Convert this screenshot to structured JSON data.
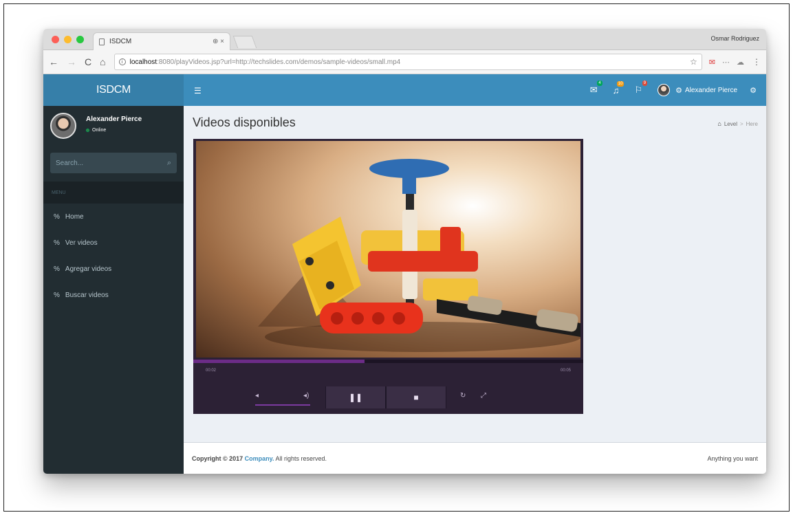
{
  "browser": {
    "tab_title": "ISDCM",
    "tab_close": "⊕ ×",
    "profile": "Osmar Rodriguez",
    "url_host": "localhost",
    "url_path": ":8080/playVideos.jsp?url=http://techslides.com/demos/sample-videos/small.mp4"
  },
  "app": {
    "logo": "ISDCM",
    "user_name": "Alexander Pierce",
    "user_status": "Online",
    "search_placeholder": "Search...",
    "menu_header": "MENU",
    "menu_items": [
      {
        "label": "Home"
      },
      {
        "label": "Ver videos"
      },
      {
        "label": "Agregar videos"
      },
      {
        "label": "Buscar videos"
      }
    ],
    "badges": {
      "messages": "4",
      "notifications": "10",
      "tasks": "9"
    }
  },
  "content": {
    "title": "Videos disponibles",
    "breadcrumb": {
      "level": "Level",
      "here": "Here"
    }
  },
  "player": {
    "time_current": "00:02",
    "time_duration": "00:05",
    "progress": 0.44,
    "volume": 1.0,
    "colors": {
      "frame": "#2c2135",
      "accent": "#6c2c87"
    }
  },
  "footer": {
    "copyright_prefix": "Copyright © 2017",
    "company": "Company.",
    "rights": "All rights reserved.",
    "right_text": "Anything you want"
  },
  "colors": {
    "header": "#3c8dbc",
    "logo_bg": "#367fa9",
    "sidebar": "#222d32"
  }
}
